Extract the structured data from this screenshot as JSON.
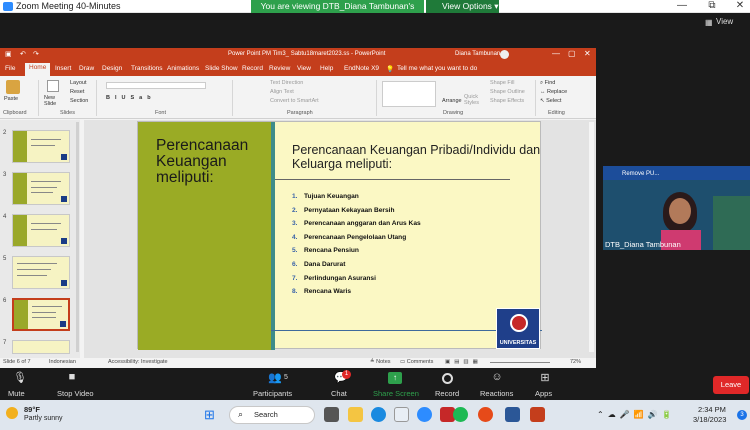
{
  "zoom": {
    "title": "Zoom Meeting 40-Minutes",
    "viewing": "You are viewing DTB_Diana Tambunan's screen",
    "view_options": "View Options",
    "view": "View",
    "minimize": "—",
    "maximize": "⧉",
    "close": "✕"
  },
  "ppt": {
    "title": "Power Point PM Tim3_ Sabtu18maret2023.ss  -  PowerPoint",
    "user": "Diana Tambunan",
    "tabs": [
      "File",
      "Home",
      "Insert",
      "Draw",
      "Design",
      "Transitions",
      "Animations",
      "Slide Show",
      "Record",
      "Review",
      "View",
      "Help",
      "EndNote X9"
    ],
    "tell": "Tell me what you want to do",
    "ribbon": {
      "paste": "Paste",
      "new_slide": "New\nSlide",
      "layout": "Layout",
      "reset": "Reset",
      "section": "Section",
      "text_direction": "Text Direction",
      "align_text": "Align Text",
      "smartart": "Convert to SmartArt",
      "arrange": "Arrange",
      "quick_styles": "Quick\nStyles",
      "shape_fill": "Shape Fill",
      "shape_outline": "Shape Outline",
      "shape_effects": "Shape Effects",
      "find": "Find",
      "replace": "Replace",
      "select": "Select",
      "groups": [
        "Clipboard",
        "Slides",
        "Font",
        "Paragraph",
        "Drawing",
        "Editing"
      ]
    },
    "thumb_numbers": [
      "2",
      "3",
      "4",
      "5",
      "6",
      "7"
    ],
    "slide": {
      "left_title": "Perencanaan Keuangan meliputi:",
      "right_title": "Perencanaan Keuangan Pribadi/Individu dan Keluarga meliputi:",
      "items": [
        {
          "n": "1.",
          "t": "Tujuan Keuangan"
        },
        {
          "n": "2.",
          "t": "Pernyataan Kekayaan Bersih"
        },
        {
          "n": "3.",
          "t": "Perencanaan anggaran dan Arus Kas"
        },
        {
          "n": "4.",
          "t": "Perencanaan Pengelolaan Utang"
        },
        {
          "n": "5.",
          "t": "Rencana Pensiun"
        },
        {
          "n": "6.",
          "t": "Dana Darurat"
        },
        {
          "n": "7.",
          "t": "Perlindungan Asuransi"
        },
        {
          "n": "8.",
          "t": "Rencana Waris"
        }
      ],
      "logo_text": "UNIVERSITAS"
    },
    "status": {
      "slide": "Slide 6 of 7",
      "lang": "Indonesian",
      "access": "Accessibility: Investigate",
      "notes": "Notes",
      "comments": "Comments",
      "zoom": "72%"
    }
  },
  "video": {
    "name": "DTB_Diana Tambunan",
    "remove": "Remove PU..."
  },
  "toolbar": {
    "mute": "Mute",
    "stop_video": "Stop Video",
    "participants": "Participants",
    "participants_count": "5",
    "chat": "Chat",
    "chat_badge": "1",
    "share": "Share Screen",
    "record": "Record",
    "reactions": "Reactions",
    "apps": "Apps",
    "leave": "Leave"
  },
  "taskbar": {
    "temp": "89°F",
    "weather": "Partly sunny",
    "search": "Search",
    "time": "2:34 PM",
    "date": "3/18/2023",
    "badge": "3"
  }
}
